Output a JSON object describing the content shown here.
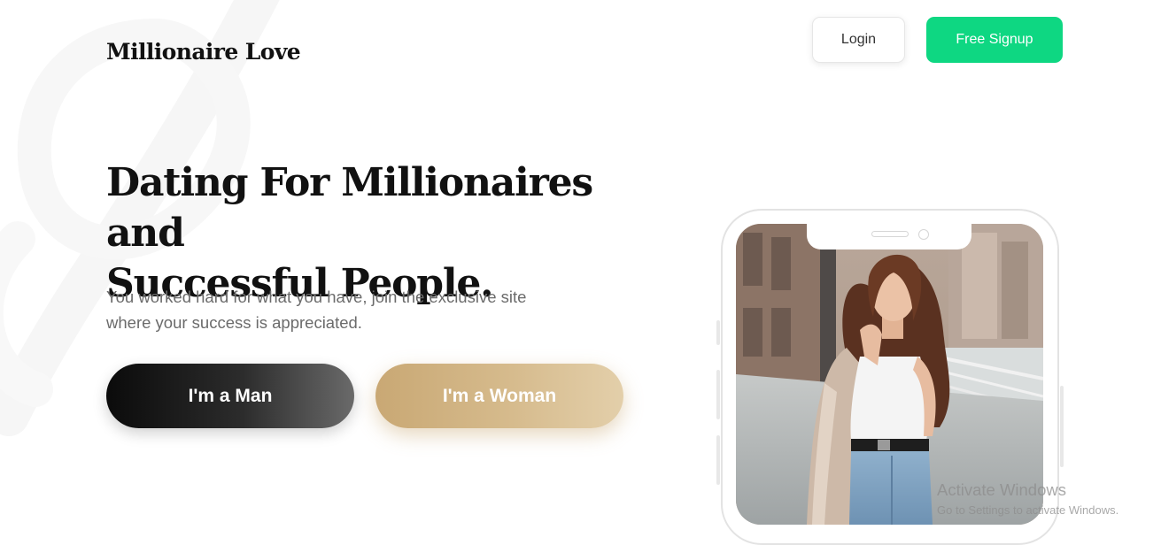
{
  "header": {
    "logo_text": "Millionaire Love",
    "login_label": "Login",
    "signup_label": "Free Signup"
  },
  "hero": {
    "headline_line1": "Dating For Millionaires and",
    "headline_line2": "Successful People.",
    "subtitle_line1": "You worked hard for what you have, join the exclusive site",
    "subtitle_line2": "where your success is appreciated.",
    "cta_man_label": "I'm a Man",
    "cta_woman_label": "I'm a Woman"
  },
  "os_watermark": {
    "title": "Activate Windows",
    "subtitle": "Go to Settings to activate Windows."
  },
  "colors": {
    "signup_green": "#0ed782",
    "man_button_dark": "#0b0b0b",
    "woman_button_gold": "#c9a874",
    "headline_text": "#111111",
    "subtitle_text": "#6b6b6b"
  }
}
